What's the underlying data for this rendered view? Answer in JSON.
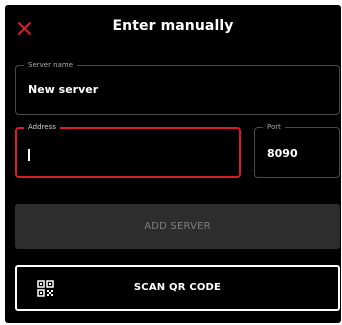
{
  "header": {
    "title": "Enter manually",
    "close_icon": "close-icon"
  },
  "form": {
    "server_name": {
      "label": "Server name",
      "value": "New server"
    },
    "address": {
      "label": "Address",
      "value": "",
      "focused": true
    },
    "port": {
      "label": "Port",
      "value": "8090"
    }
  },
  "actions": {
    "add_server_label": "ADD SERVER",
    "add_server_enabled": false,
    "scan_qr_label": "SCAN QR CODE",
    "scan_qr_icon": "qr-code-icon"
  },
  "colors": {
    "background": "#000000",
    "accent": "#d81d2a",
    "disabled_button": "#2d2d2d",
    "disabled_text": "#7e7e7e",
    "text": "#ffffff"
  }
}
